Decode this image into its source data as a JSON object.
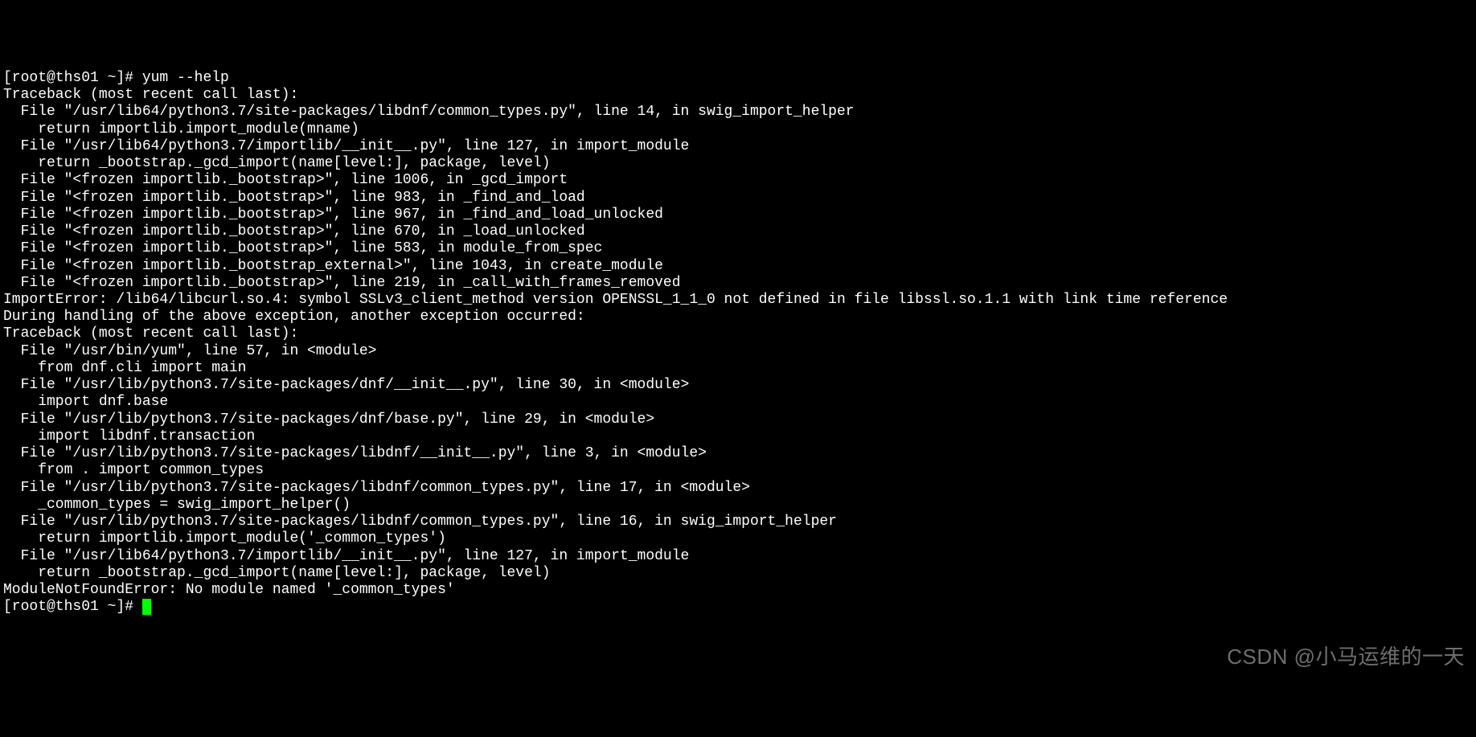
{
  "terminal": {
    "lines": [
      "[root@ths01 ~]# yum --help",
      "Traceback (most recent call last):",
      "  File \"/usr/lib64/python3.7/site-packages/libdnf/common_types.py\", line 14, in swig_import_helper",
      "    return importlib.import_module(mname)",
      "  File \"/usr/lib64/python3.7/importlib/__init__.py\", line 127, in import_module",
      "    return _bootstrap._gcd_import(name[level:], package, level)",
      "  File \"<frozen importlib._bootstrap>\", line 1006, in _gcd_import",
      "  File \"<frozen importlib._bootstrap>\", line 983, in _find_and_load",
      "  File \"<frozen importlib._bootstrap>\", line 967, in _find_and_load_unlocked",
      "  File \"<frozen importlib._bootstrap>\", line 670, in _load_unlocked",
      "  File \"<frozen importlib._bootstrap>\", line 583, in module_from_spec",
      "  File \"<frozen importlib._bootstrap_external>\", line 1043, in create_module",
      "  File \"<frozen importlib._bootstrap>\", line 219, in _call_with_frames_removed",
      "ImportError: /lib64/libcurl.so.4: symbol SSLv3_client_method version OPENSSL_1_1_0 not defined in file libssl.so.1.1 with link time reference",
      "",
      "During handling of the above exception, another exception occurred:",
      "",
      "Traceback (most recent call last):",
      "  File \"/usr/bin/yum\", line 57, in <module>",
      "    from dnf.cli import main",
      "  File \"/usr/lib/python3.7/site-packages/dnf/__init__.py\", line 30, in <module>",
      "    import dnf.base",
      "  File \"/usr/lib/python3.7/site-packages/dnf/base.py\", line 29, in <module>",
      "    import libdnf.transaction",
      "  File \"/usr/lib/python3.7/site-packages/libdnf/__init__.py\", line 3, in <module>",
      "    from . import common_types",
      "  File \"/usr/lib/python3.7/site-packages/libdnf/common_types.py\", line 17, in <module>",
      "    _common_types = swig_import_helper()",
      "  File \"/usr/lib/python3.7/site-packages/libdnf/common_types.py\", line 16, in swig_import_helper",
      "    return importlib.import_module('_common_types')",
      "  File \"/usr/lib64/python3.7/importlib/__init__.py\", line 127, in import_module",
      "    return _bootstrap._gcd_import(name[level:], package, level)",
      "ModuleNotFoundError: No module named '_common_types'"
    ],
    "prompt_final": "[root@ths01 ~]# "
  },
  "watermark": "CSDN @小马运维的一天"
}
